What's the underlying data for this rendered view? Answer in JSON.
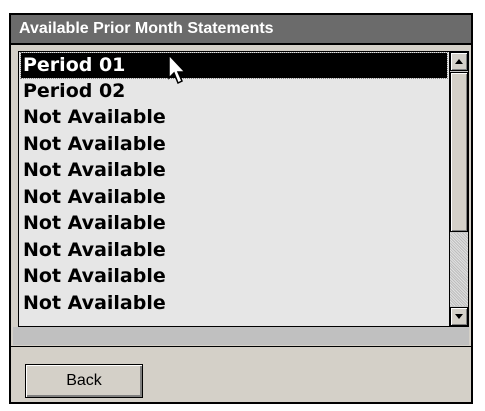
{
  "window": {
    "title": "Available Prior Month Statements"
  },
  "list": {
    "items": [
      {
        "label": "Period 01",
        "selected": true
      },
      {
        "label": "Period 02",
        "selected": false
      },
      {
        "label": "Not Available",
        "selected": false
      },
      {
        "label": "Not Available",
        "selected": false
      },
      {
        "label": "Not Available",
        "selected": false
      },
      {
        "label": "Not Available",
        "selected": false
      },
      {
        "label": "Not Available",
        "selected": false
      },
      {
        "label": "Not Available",
        "selected": false
      },
      {
        "label": "Not Available",
        "selected": false
      },
      {
        "label": "Not Available",
        "selected": false
      }
    ]
  },
  "scrollbar": {
    "up_icon": "arrow-up-icon",
    "down_icon": "arrow-down-icon"
  },
  "buttons": {
    "back_label": "Back"
  },
  "cursor": {
    "icon": "arrow-cursor-icon"
  },
  "colors": {
    "titlebar_bg": "#6b6b6b",
    "selection_bg": "#000000",
    "list_bg": "#e6e6e6",
    "face": "#d4d0c8"
  }
}
